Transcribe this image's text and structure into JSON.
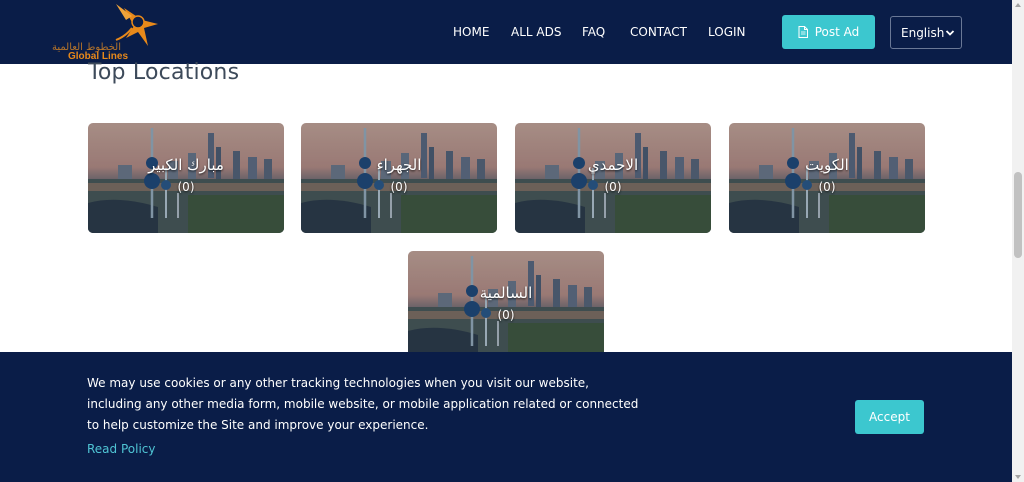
{
  "brand": {
    "arabic_name": "الخطوط العالمية",
    "name": "Global Lines",
    "accent": "#e8891a"
  },
  "nav": {
    "links": [
      "HOME",
      "ALL ADS",
      "FAQ",
      "CONTACT",
      "LOGIN"
    ],
    "post_ad_label": "Post Ad",
    "language": "English"
  },
  "section": {
    "title": "Top Locations"
  },
  "locations": [
    {
      "name": "مبارك الكبير",
      "count": "(0)"
    },
    {
      "name": "الجهراء",
      "count": "(0)"
    },
    {
      "name": "الاحمدي",
      "count": "(0)"
    },
    {
      "name": "الكويت",
      "count": "(0)"
    },
    {
      "name": "السالمية",
      "count": "(0)"
    }
  ],
  "cookie": {
    "message": "We may use cookies or any other tracking technologies when you visit our website, including any other media form, mobile website, or mobile application related or connected to help customize the Site and improve your experience.",
    "read_policy": "Read Policy",
    "accept": "Accept"
  },
  "colors": {
    "navy": "#0a1d48",
    "teal": "#3cc7cf",
    "link": "#4fc4d4"
  }
}
